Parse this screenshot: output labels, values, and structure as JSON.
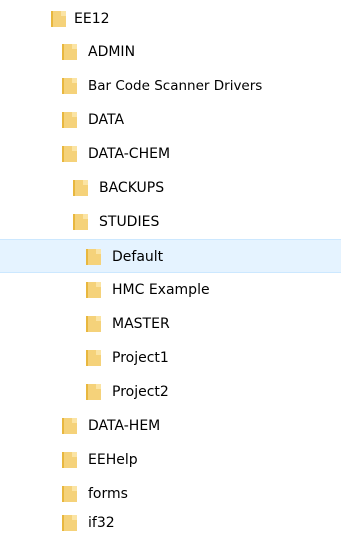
{
  "tree": {
    "items": [
      {
        "label": "EE12",
        "level": 0,
        "icon": "folder-icon",
        "selected": false
      },
      {
        "label": "ADMIN",
        "level": 1,
        "icon": "folder-icon",
        "selected": false
      },
      {
        "label": "Bar Code Scanner Drivers",
        "level": 1,
        "icon": "folder-icon",
        "selected": false
      },
      {
        "label": "DATA",
        "level": 1,
        "icon": "folder-icon",
        "selected": false
      },
      {
        "label": "DATA-CHEM",
        "level": 1,
        "icon": "folder-icon",
        "selected": false
      },
      {
        "label": "BACKUPS",
        "level": 2,
        "icon": "folder-icon",
        "selected": false
      },
      {
        "label": "STUDIES",
        "level": 2,
        "icon": "folder-icon",
        "selected": false
      },
      {
        "label": "Default",
        "level": 3,
        "icon": "folder-icon",
        "selected": true
      },
      {
        "label": "HMC Example",
        "level": 3,
        "icon": "folder-icon",
        "selected": false
      },
      {
        "label": "MASTER",
        "level": 3,
        "icon": "folder-icon",
        "selected": false
      },
      {
        "label": "Project1",
        "level": 3,
        "icon": "folder-icon",
        "selected": false
      },
      {
        "label": "Project2",
        "level": 3,
        "icon": "folder-icon",
        "selected": false
      },
      {
        "label": "DATA-HEM",
        "level": 1,
        "icon": "folder-icon",
        "selected": false
      },
      {
        "label": "EEHelp",
        "level": 1,
        "icon": "folder-icon",
        "selected": false
      },
      {
        "label": "forms",
        "level": 1,
        "icon": "folder-icon",
        "selected": false
      },
      {
        "label": "if32",
        "level": 1,
        "icon": "folder-icon",
        "selected": false
      }
    ]
  },
  "colors": {
    "selected_background": "#e5f3ff",
    "selected_border": "#cce8ff",
    "folder": "#f5d27a"
  }
}
